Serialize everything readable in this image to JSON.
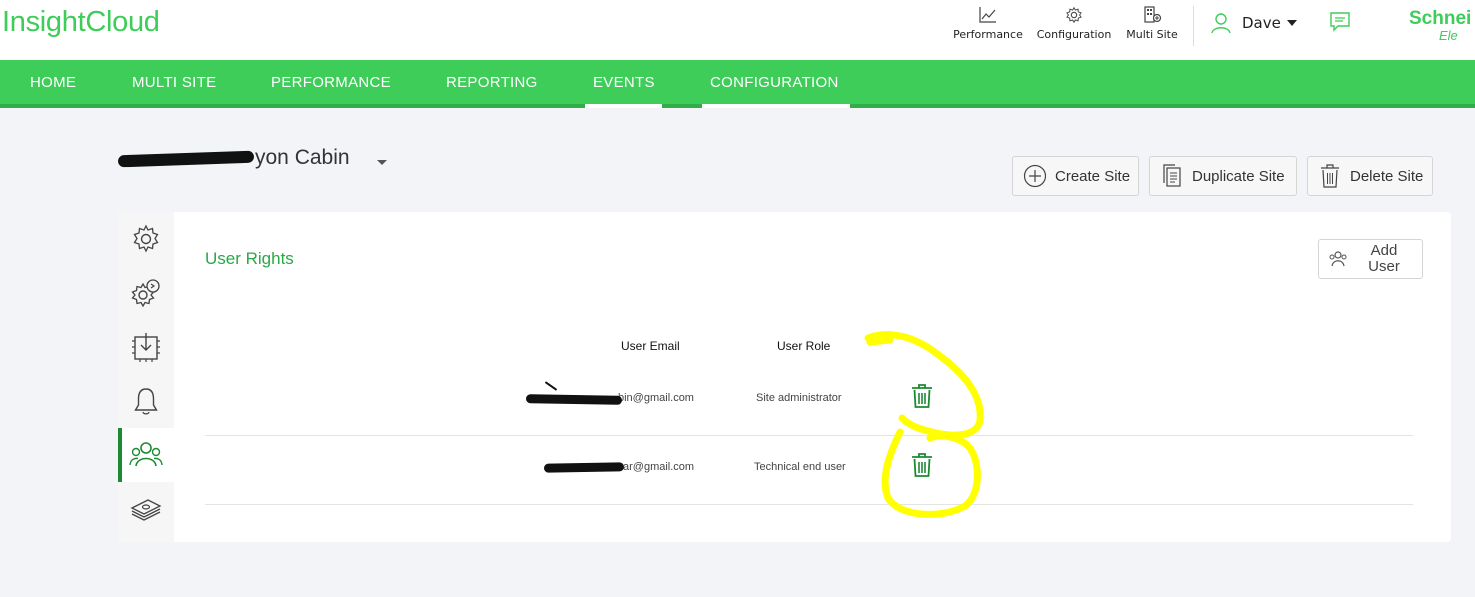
{
  "app": {
    "title": "InsightCloud",
    "brand_line1": "Schnei",
    "brand_line2": "Ele"
  },
  "top_links": [
    {
      "label": "Performance",
      "icon": "chart-line-icon"
    },
    {
      "label": "Configuration",
      "icon": "gear-icon"
    },
    {
      "label": "Multi Site",
      "icon": "building-icon"
    }
  ],
  "user": {
    "name": "Dave"
  },
  "nav": {
    "items": [
      "HOME",
      "MULTI SITE",
      "PERFORMANCE",
      "REPORTING",
      "EVENTS",
      "CONFIGURATION"
    ],
    "active": [
      "EVENTS",
      "CONFIGURATION"
    ]
  },
  "site": {
    "name_visible": "yon Cabin"
  },
  "actions": {
    "create": "Create Site",
    "duplicate": "Duplicate Site",
    "delete": "Delete Site"
  },
  "section": {
    "title": "User Rights",
    "add_user": "Add User",
    "columns": {
      "email": "User Email",
      "role": "User Role"
    },
    "rows": [
      {
        "email_visible": "bin@gmail.com",
        "role": "Site administrator"
      },
      {
        "email_visible": "ar@gmail.com",
        "role": "Technical end user"
      }
    ]
  },
  "sidebar_icons": [
    "gear-icon",
    "gear-settings-icon",
    "download-chip-icon",
    "bell-icon",
    "users-icon",
    "money-icon"
  ],
  "colors": {
    "brand_green": "#3dcd58",
    "dark_green": "#1d8a33",
    "highlight": "#ffff00"
  }
}
